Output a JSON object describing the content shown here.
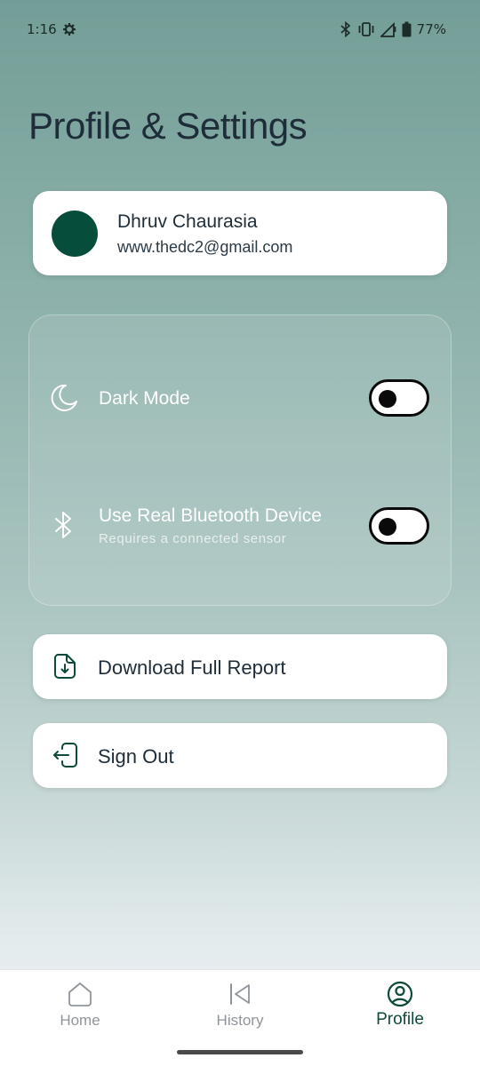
{
  "status_bar": {
    "time": "1:16",
    "battery": "77%",
    "icons": [
      "gear-icon",
      "bluetooth-icon",
      "vibrate-icon",
      "signal-icon",
      "battery-icon"
    ]
  },
  "page": {
    "title": "Profile & Settings"
  },
  "profile": {
    "name": "Dhruv Chaurasia",
    "email": "www.thedc2@gmail.com",
    "avatar_color": "#064d3c"
  },
  "settings": {
    "dark_mode": {
      "label": "Dark Mode",
      "icon": "moon-icon",
      "enabled": false
    },
    "bluetooth": {
      "label": "Use Real Bluetooth Device",
      "subtitle": "Requires a connected sensor",
      "icon": "bluetooth-icon",
      "enabled": false
    }
  },
  "actions": {
    "download": {
      "label": "Download Full Report",
      "icon": "download-file-icon"
    },
    "signout": {
      "label": "Sign Out",
      "icon": "sign-out-icon"
    }
  },
  "nav": {
    "items": [
      {
        "label": "Home",
        "icon": "home-icon",
        "active": false
      },
      {
        "label": "History",
        "icon": "history-icon",
        "active": false
      },
      {
        "label": "Profile",
        "icon": "profile-icon",
        "active": true
      }
    ]
  },
  "colors": {
    "accent": "#0d4a3c",
    "text_dark": "#1e2d39",
    "background_top": "#739e97",
    "background_bottom": "#eef1f6"
  }
}
